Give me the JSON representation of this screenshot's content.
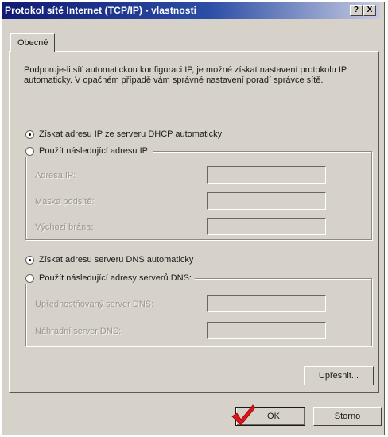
{
  "window": {
    "title": "Protokol sítě Internet (TCP/IP) - vlastnosti",
    "help_label": "?",
    "close_label": "X"
  },
  "tabs": [
    {
      "label": "Obecné",
      "active": true
    }
  ],
  "description": "Podporuje-li síť automatickou konfiguraci IP, je možné získat nastavení protokolu IP automaticky. V opačném případě vám správné nastavení poradí správce sítě.",
  "ip": {
    "auto_label": "Získat adresu IP ze serveru DHCP automaticky",
    "auto_selected": true,
    "manual_label": "Použít následující adresu IP:",
    "fields": [
      {
        "label": "Adresa IP:",
        "value": ""
      },
      {
        "label": "Maska podsítě:",
        "value": ""
      },
      {
        "label": "Výchozí brána:",
        "value": ""
      }
    ]
  },
  "dns": {
    "auto_label": "Získat adresu serveru DNS automaticky",
    "auto_selected": true,
    "manual_label": "Použít následující adresy serverů DNS:",
    "fields": [
      {
        "label": "Upřednostňovaný server DNS:",
        "value": ""
      },
      {
        "label": "Náhradní server DNS:",
        "value": ""
      }
    ]
  },
  "buttons": {
    "advanced": "Upřesnit...",
    "ok": "OK",
    "cancel": "Storno"
  },
  "icons": {
    "ok_check": "red-checkmark-icon"
  },
  "colors": {
    "title_start": "#101a72",
    "title_end": "#c7cbe0",
    "dialog_bg": "#d6d2c9",
    "check_red": "#e0121a"
  }
}
